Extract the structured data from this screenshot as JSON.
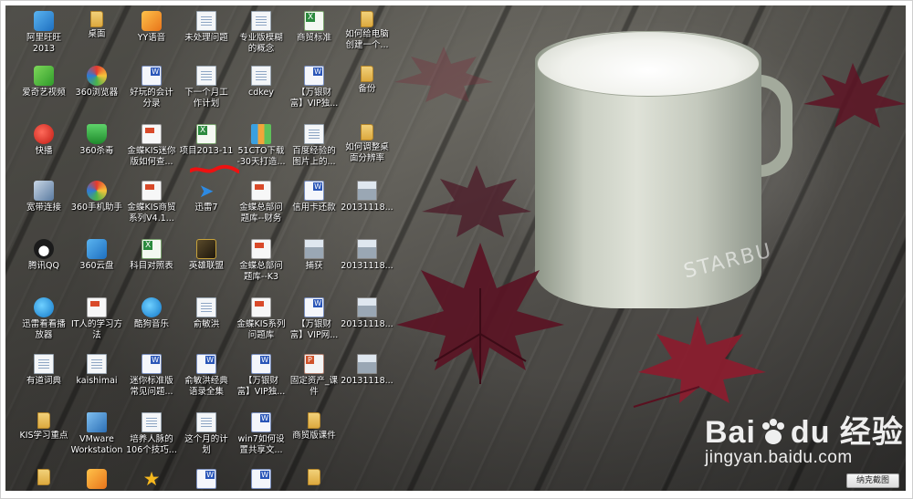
{
  "desktop": {
    "icons": [
      {
        "label": "阿里旺旺\n2013",
        "icon": "aliwangwang-icon",
        "kind": "ic-app"
      },
      {
        "label": "爱奇艺视频",
        "icon": "iqiyi-icon",
        "kind": "ic-green"
      },
      {
        "label": "快播",
        "icon": "qvod-icon",
        "kind": "ic-red"
      },
      {
        "label": "宽带连接",
        "icon": "network-icon",
        "kind": "ic-net"
      },
      {
        "label": "腾讯QQ",
        "icon": "qq-icon",
        "kind": "ic-penguin"
      },
      {
        "label": "迅雷看看播\n放器",
        "icon": "xunlei-player-icon",
        "kind": "ic-blue-circle"
      },
      {
        "label": "有道词典",
        "icon": "youdao-icon",
        "kind": "ic-doc"
      },
      {
        "label": "KIS学习重点",
        "icon": "folder-icon",
        "kind": "ic-folder"
      },
      {
        "label": "",
        "icon": "folder-icon",
        "kind": "ic-folder"
      },
      {
        "label": "桌面",
        "icon": "folder-icon",
        "kind": "ic-folder"
      },
      {
        "label": "360浏览器",
        "icon": "360-browser-icon",
        "kind": "ic-color"
      },
      {
        "label": "360杀毒",
        "icon": "360-antivirus-icon",
        "kind": "ic-shield"
      },
      {
        "label": "360手机助手",
        "icon": "360-phone-icon",
        "kind": "ic-color"
      },
      {
        "label": "360云盘",
        "icon": "360-cloud-icon",
        "kind": "ic-app"
      },
      {
        "label": "IT人的学习方\n法",
        "icon": "pdf-icon",
        "kind": "ic-pdf"
      },
      {
        "label": "kaishimai",
        "icon": "document-icon",
        "kind": "ic-doc"
      },
      {
        "label": "VMware\nWorkstation",
        "icon": "vmware-icon",
        "kind": "ic-vm"
      },
      {
        "label": "",
        "icon": "game-icon",
        "kind": "ic-orange"
      },
      {
        "label": "YY语音",
        "icon": "yy-icon",
        "kind": "ic-orange"
      },
      {
        "label": "好玩的会计\n分录",
        "icon": "word-icon",
        "kind": "ic-word"
      },
      {
        "label": "金蝶KIS迷你\n版如何查...",
        "icon": "pdf-icon",
        "kind": "ic-pdf"
      },
      {
        "label": "金蝶KIS商贸\n系列V4.1...",
        "icon": "pdf-icon",
        "kind": "ic-pdf"
      },
      {
        "label": "科目对照表",
        "icon": "excel-icon",
        "kind": "ic-excel"
      },
      {
        "label": "酷狗音乐",
        "icon": "kugou-icon",
        "kind": "ic-blue-circle"
      },
      {
        "label": "迷你标准版\n常见问题...",
        "icon": "word-icon",
        "kind": "ic-word"
      },
      {
        "label": "培养人脉的\n106个技巧...",
        "icon": "document-icon",
        "kind": "ic-doc"
      },
      {
        "label": "",
        "icon": "star-icon",
        "kind": "ic-star"
      },
      {
        "label": "未处理问题",
        "icon": "document-icon",
        "kind": "ic-doc"
      },
      {
        "label": "下一个月工\n作计划",
        "icon": "document-icon",
        "kind": "ic-doc"
      },
      {
        "label": "项目2013-11",
        "icon": "excel-icon",
        "kind": "ic-excel"
      },
      {
        "label": "迅雷7",
        "icon": "xunlei-icon",
        "kind": "ic-arrow"
      },
      {
        "label": "英雄联盟",
        "icon": "lol-icon",
        "kind": "ic-dark"
      },
      {
        "label": "俞敏洪",
        "icon": "document-icon",
        "kind": "ic-doc"
      },
      {
        "label": "俞敏洪经典\n语录全集",
        "icon": "word-icon",
        "kind": "ic-word"
      },
      {
        "label": "这个月的计\n划",
        "icon": "document-icon",
        "kind": "ic-doc"
      },
      {
        "label": "",
        "icon": "word-icon",
        "kind": "ic-word"
      },
      {
        "label": "专业版模糊\n的概念",
        "icon": "document-icon",
        "kind": "ic-doc"
      },
      {
        "label": "cdkey",
        "icon": "document-icon",
        "kind": "ic-doc"
      },
      {
        "label": "51CTO下载\n-30天打造...",
        "icon": "books-icon",
        "kind": "ic-books"
      },
      {
        "label": "金蝶总部问\n题库--财务",
        "icon": "pdf-icon",
        "kind": "ic-pdf"
      },
      {
        "label": "金蝶总部问\n题库--K3",
        "icon": "pdf-icon",
        "kind": "ic-pdf"
      },
      {
        "label": "金蝶KIS系列\n问题库",
        "icon": "pdf-icon",
        "kind": "ic-pdf"
      },
      {
        "label": "【万银财\n富】VIP独...",
        "icon": "word-icon",
        "kind": "ic-word"
      },
      {
        "label": "win7如何设\n置共享文...",
        "icon": "word-icon",
        "kind": "ic-word"
      },
      {
        "label": "",
        "icon": "word-icon",
        "kind": "ic-word"
      },
      {
        "label": "商贸标准",
        "icon": "excel-icon",
        "kind": "ic-excel"
      },
      {
        "label": "【万银财\n富】VIP独...",
        "icon": "word-icon",
        "kind": "ic-word"
      },
      {
        "label": "百度经验的\n图片上的...",
        "icon": "document-icon",
        "kind": "ic-doc"
      },
      {
        "label": "信用卡还款",
        "icon": "word-icon",
        "kind": "ic-word"
      },
      {
        "label": "捕获",
        "icon": "image-icon",
        "kind": "ic-img"
      },
      {
        "label": "【万银财\n富】VIP网...",
        "icon": "word-icon",
        "kind": "ic-word"
      },
      {
        "label": "固定资产_课\n件",
        "icon": "ppt-icon",
        "kind": "ic-ppt"
      },
      {
        "label": "商贸版课件",
        "icon": "folder-icon",
        "kind": "ic-folder"
      },
      {
        "label": "",
        "icon": "folder-icon",
        "kind": "ic-folder"
      },
      {
        "label": "如何给电脑\n创建一个...",
        "icon": "folder-icon",
        "kind": "ic-folder"
      },
      {
        "label": "备份",
        "icon": "folder-icon",
        "kind": "ic-folder"
      },
      {
        "label": "如何调整桌\n面分辨率",
        "icon": "folder-icon",
        "kind": "ic-folder"
      },
      {
        "label": "20131118...",
        "icon": "image-icon",
        "kind": "ic-img"
      },
      {
        "label": "20131118...",
        "icon": "image-icon",
        "kind": "ic-img"
      },
      {
        "label": "20131118...",
        "icon": "image-icon",
        "kind": "ic-img"
      },
      {
        "label": "20131118...",
        "icon": "image-icon",
        "kind": "ic-img"
      }
    ]
  },
  "mug": {
    "brand": "STARBU"
  },
  "watermark": {
    "logo_left": "Bai",
    "logo_right": "经验",
    "logo_mid": "du",
    "url": "jingyan.baidu.com"
  },
  "capture_button": {
    "label": "纳克截图"
  }
}
